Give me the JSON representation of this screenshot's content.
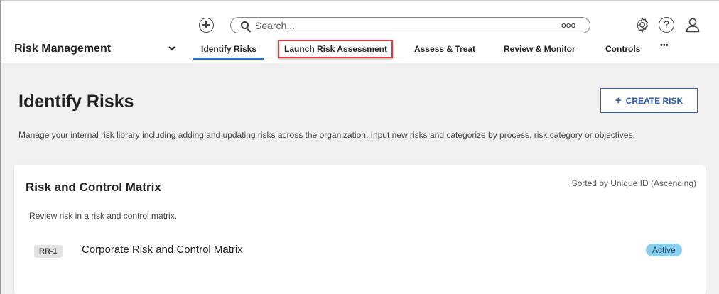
{
  "topbar": {
    "search_placeholder": "Search...",
    "search_options_glyph": "ooo"
  },
  "nav": {
    "app_title": "Risk Management",
    "tabs": [
      {
        "label": "Identify Risks",
        "active": true
      },
      {
        "label": "Launch Risk Assessment",
        "highlighted": true
      },
      {
        "label": "Assess & Treat"
      },
      {
        "label": "Review & Monitor"
      },
      {
        "label": "Controls"
      }
    ],
    "more_glyph": "•••"
  },
  "page": {
    "title": "Identify Risks",
    "create_button": "CREATE RISK",
    "description": "Manage your internal risk library including adding and updating risks across the organization. Input new risks and categorize by process, risk category or objectives."
  },
  "card": {
    "title": "Risk and Control Matrix",
    "sort_label": "Sorted by Unique ID (Ascending)",
    "description": "Review risk in a risk and control matrix.",
    "rows": [
      {
        "id": "RR-1",
        "name": "Corporate Risk and Control Matrix",
        "status": "Active"
      }
    ]
  },
  "colors": {
    "accent": "#2f6fd1",
    "button_border": "#2f5bb3",
    "highlight": "#e03d45",
    "status_badge": "#8ad0ee",
    "content_bg": "#f0f0f0"
  },
  "icons": [
    "add-circle-icon",
    "search-icon",
    "more-options-icon",
    "gear-icon",
    "help-icon",
    "user-icon",
    "chevron-down-icon",
    "plus-icon"
  ]
}
